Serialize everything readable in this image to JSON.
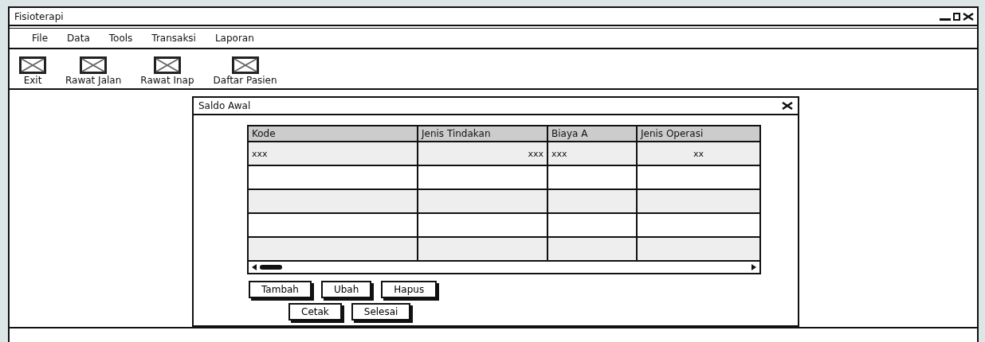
{
  "window": {
    "title": "Fisioterapi"
  },
  "menu": [
    "File",
    "Data",
    "Tools",
    "Transaksi",
    "Laporan"
  ],
  "toolbar": [
    {
      "label": "Exit"
    },
    {
      "label": "Rawat Jalan"
    },
    {
      "label": "Rawat Inap"
    },
    {
      "label": "Daftar Pasien"
    }
  ],
  "dialog": {
    "title": "Saldo Awal",
    "table": {
      "columns": [
        "Kode",
        "Jenis Tindakan",
        "Biaya A",
        "Jenis Operasi"
      ],
      "rows": [
        [
          "xxx",
          "xxx",
          "xxx",
          "xx"
        ]
      ]
    },
    "button_rows": [
      [
        "Tambah",
        "Ubah",
        "Hapus"
      ],
      [
        "Cetak",
        "Selesai"
      ]
    ]
  }
}
